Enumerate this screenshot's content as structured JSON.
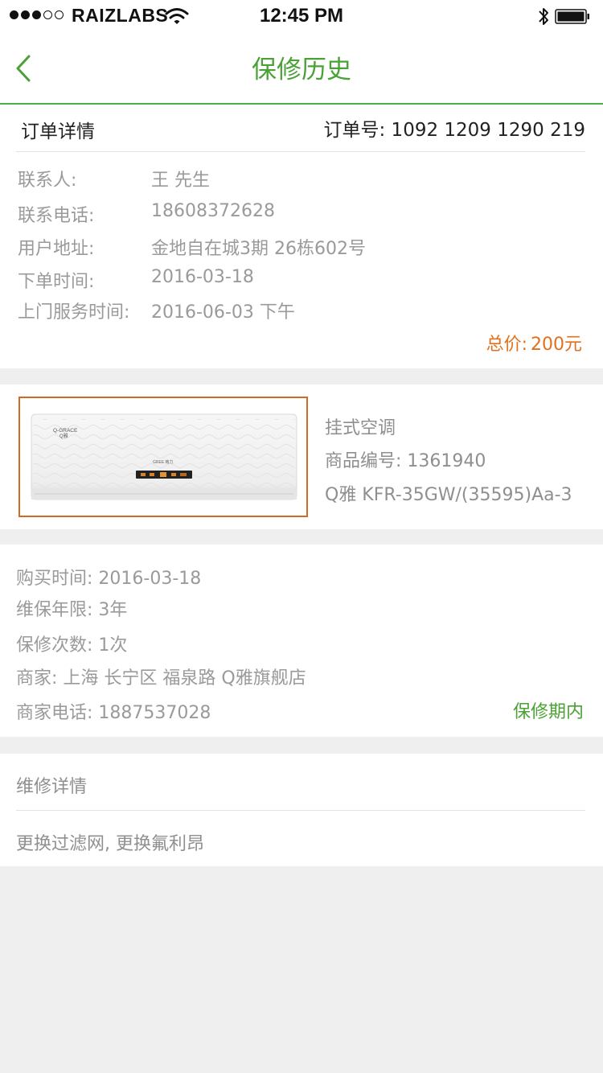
{
  "status_bar": {
    "carrier": "RAIZLABS",
    "time": "12:45 PM",
    "signal_bars_filled": 3,
    "signal_bars_total": 5,
    "icons": [
      "wifi-icon",
      "bluetooth-icon",
      "battery-icon"
    ]
  },
  "nav": {
    "title": "保修历史",
    "back_icon": "chevron-left-icon"
  },
  "order": {
    "header_title": "订单详情",
    "order_number": "订单号: 1092 1209 1290 219",
    "rows": [
      {
        "label": "联系人:",
        "value": "王   先生"
      },
      {
        "label": "联系电话:",
        "value": "18608372628"
      },
      {
        "label": "用户地址:",
        "value": "金地自在城3期   26栋602号"
      },
      {
        "label": "下单时间:",
        "value": "2016-03-18"
      },
      {
        "label": "上门服务时间:",
        "value": "2016-06-03 下午"
      }
    ],
    "total_label": "总价:",
    "total_value": "200元"
  },
  "product": {
    "name": "挂式空调",
    "code": "商品编号: 1361940",
    "model": "Q雅 KFR-35GW/(35595)Aa-3",
    "image_brand_left": "Q-GRACE",
    "image_brand_center": "GREE"
  },
  "purchase": {
    "rows": [
      {
        "text": "购买时间: 2016-03-18"
      },
      {
        "text": "维保年限: 3年"
      },
      {
        "text": "保修次数: 1次"
      },
      {
        "text": "商家: 上海  长宁区  福泉路  Q雅旗舰店"
      },
      {
        "text": "商家电话: 1887537028"
      }
    ],
    "warranty_status": "保修期内"
  },
  "repair": {
    "title": "维修详情",
    "detail": "更换过滤网, 更换氟利昂"
  },
  "colors": {
    "accent_green": "#4aa236",
    "price_orange": "#e2711d",
    "image_border": "#d26a25",
    "background": "#efefef"
  }
}
